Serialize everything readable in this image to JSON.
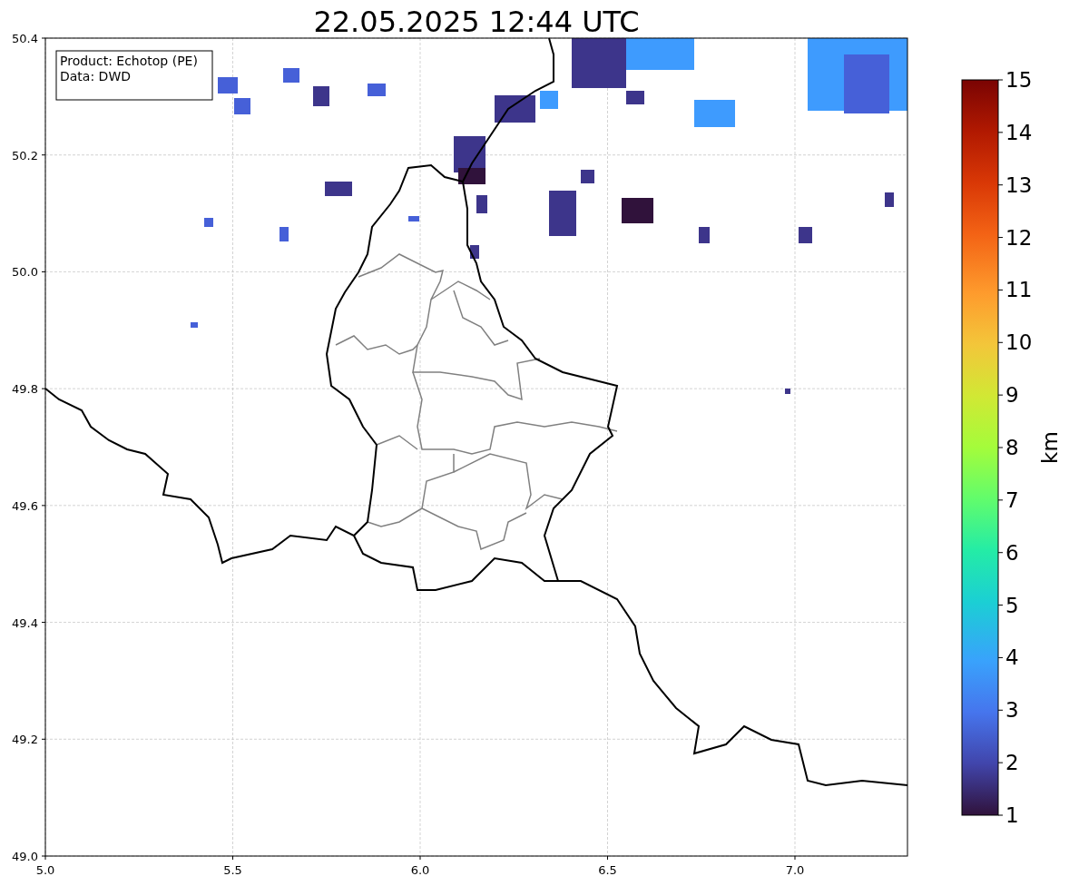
{
  "title": "22.05.2025 12:44 UTC",
  "legend": {
    "lines": [
      "Product: Echotop (PE)",
      "Data: DWD"
    ]
  },
  "x_axis": {
    "ticks": [
      "5.0",
      "5.5",
      "6.0",
      "6.5",
      "7.0"
    ]
  },
  "y_axis": {
    "ticks": [
      "50.4",
      "50.2",
      "50.0",
      "49.8",
      "49.6",
      "49.4",
      "49.2",
      "49.0"
    ]
  },
  "colorbar": {
    "label": "km",
    "ticks": [
      "15",
      "14",
      "13",
      "12",
      "11",
      "10",
      "9",
      "8",
      "7",
      "6",
      "5",
      "4",
      "3",
      "2",
      "1"
    ]
  }
}
